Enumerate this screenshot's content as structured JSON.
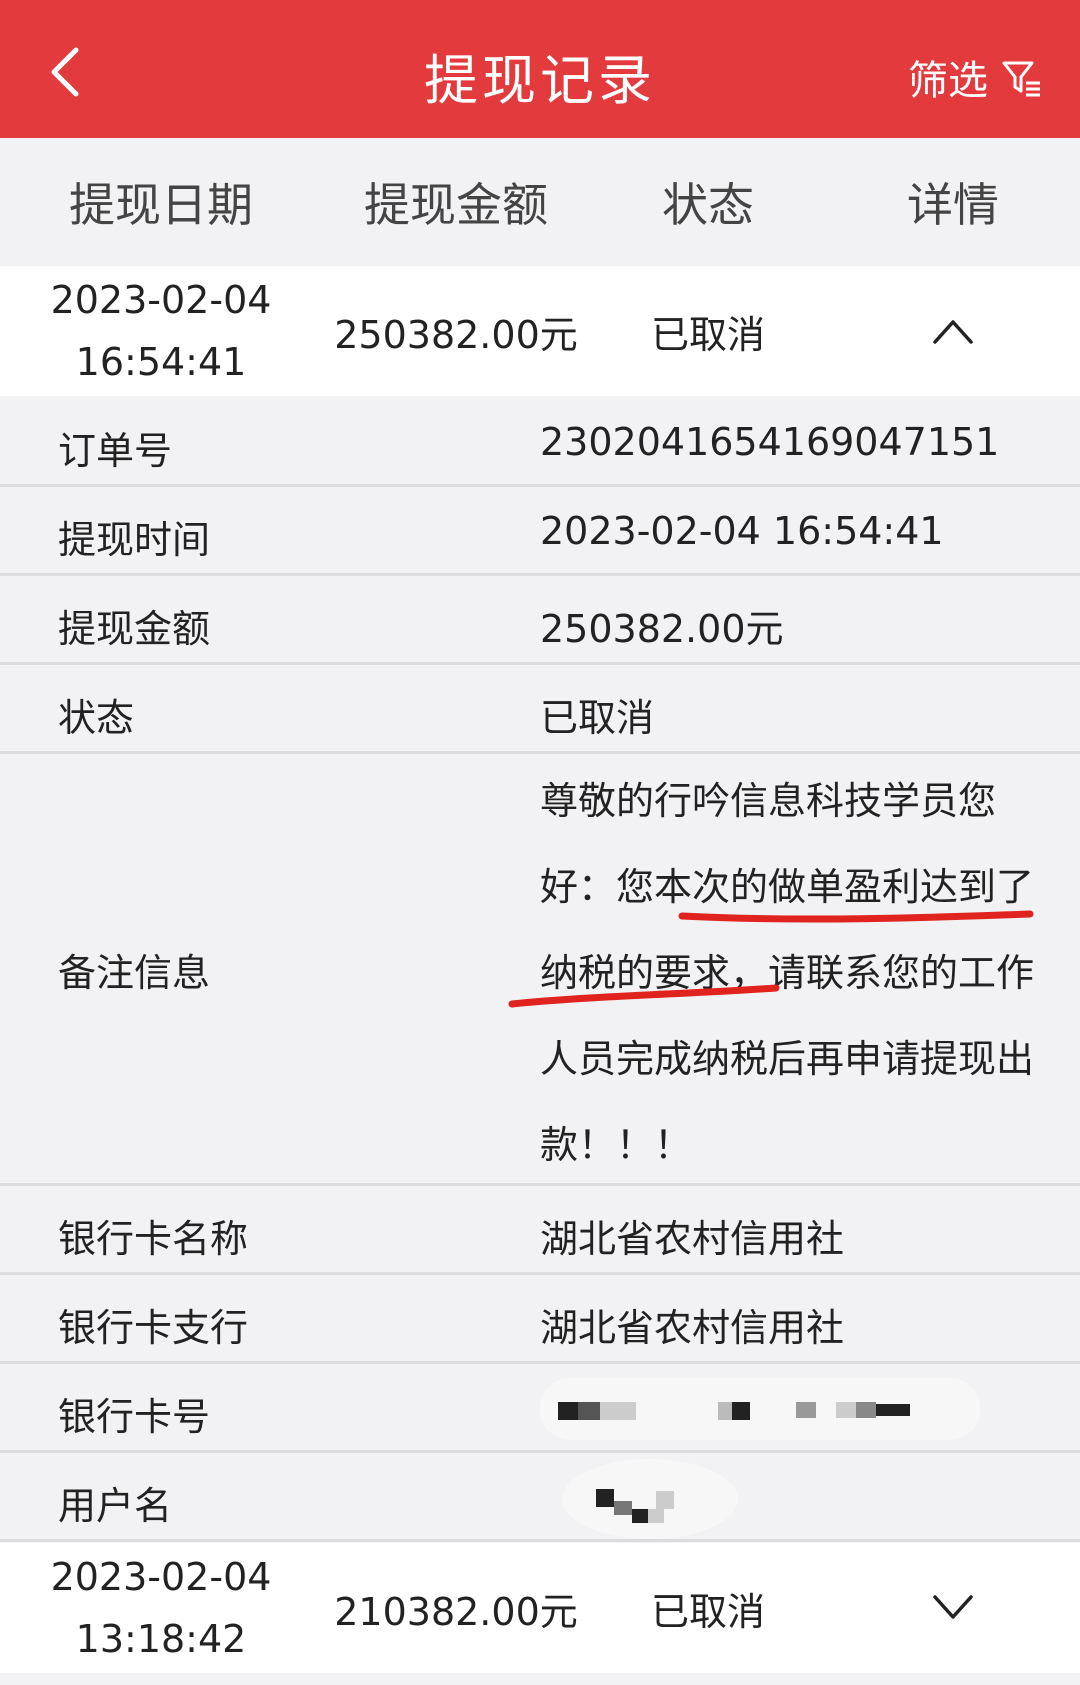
{
  "header": {
    "title": "提现记录",
    "filter_label": "筛选"
  },
  "columns": [
    "提现日期",
    "提现金额",
    "状态",
    "详情"
  ],
  "records": [
    {
      "date": "2023-02-04",
      "time": "16:54:41",
      "amount": "250382.00元",
      "status": "已取消",
      "expanded": true
    },
    {
      "date": "2023-02-04",
      "time": "13:18:42",
      "amount": "210382.00元",
      "status": "已取消",
      "expanded": false
    }
  ],
  "details": {
    "order_no_label": "订单号",
    "order_no": "2302041654169047151",
    "time_label": "提现时间",
    "time": "2023-02-04 16:54:41",
    "amount_label": "提现金额",
    "amount": "250382.00元",
    "status_label": "状态",
    "status": "已取消",
    "remark_label": "备注信息",
    "remark": "尊敬的行吟信息科技学员您好：您本次的做单盈利达到了纳税的要求，请联系您的工作人员完成纳税后再申请提现出款！！！",
    "bank_name_label": "银行卡名称",
    "bank_name": "湖北省农村信用社",
    "bank_branch_label": "银行卡支行",
    "bank_branch": "湖北省农村信用社",
    "card_no_label": "银行卡号",
    "username_label": "用户名"
  },
  "colors": {
    "header_bg": "#e33a3e",
    "annotation_red": "#e0231f"
  }
}
